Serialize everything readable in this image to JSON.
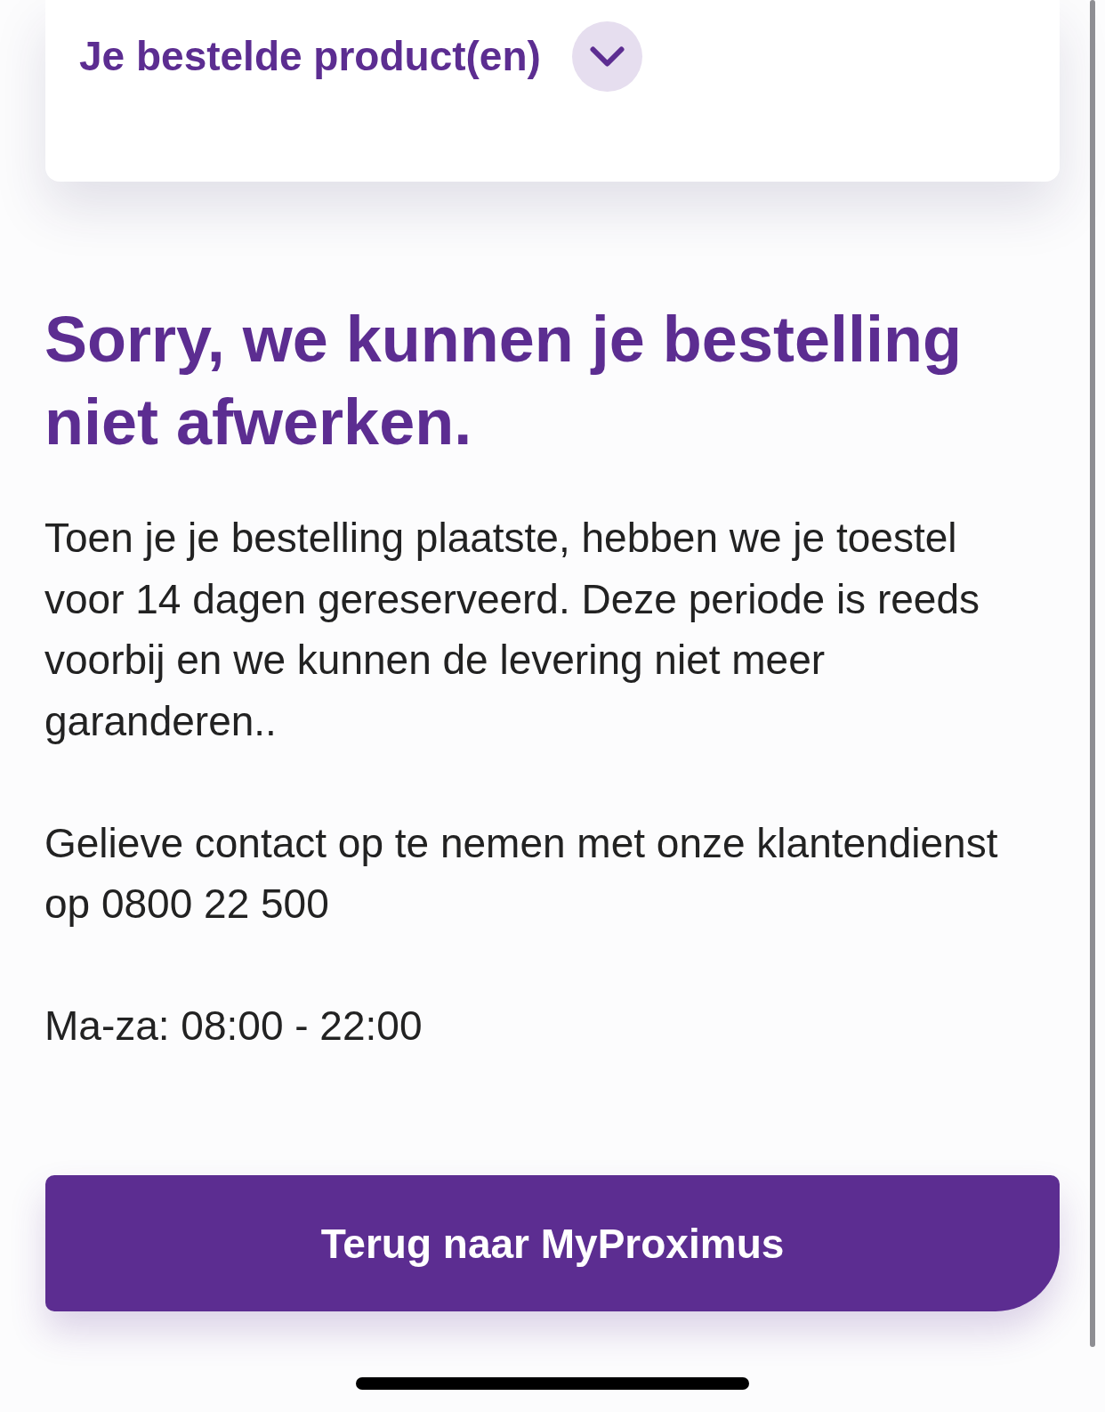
{
  "product_section": {
    "title": "Je bestelde product(en)",
    "expanded": false
  },
  "heading": "Sorry, we kunnen je bestelling niet afwerken.",
  "paragraphs": [
    "Toen je je bestelling plaatste, hebben we je toestel voor 14 dagen gereserveerd. Deze periode is reeds voorbij en we kunnen de levering niet meer garanderen..",
    "Gelieve contact op te nemen met onze klantendienst op 0800 22 500",
    "Ma-za: 08:00 - 22:00"
  ],
  "primary_button": {
    "label": "Terug naar MyProximus"
  }
}
